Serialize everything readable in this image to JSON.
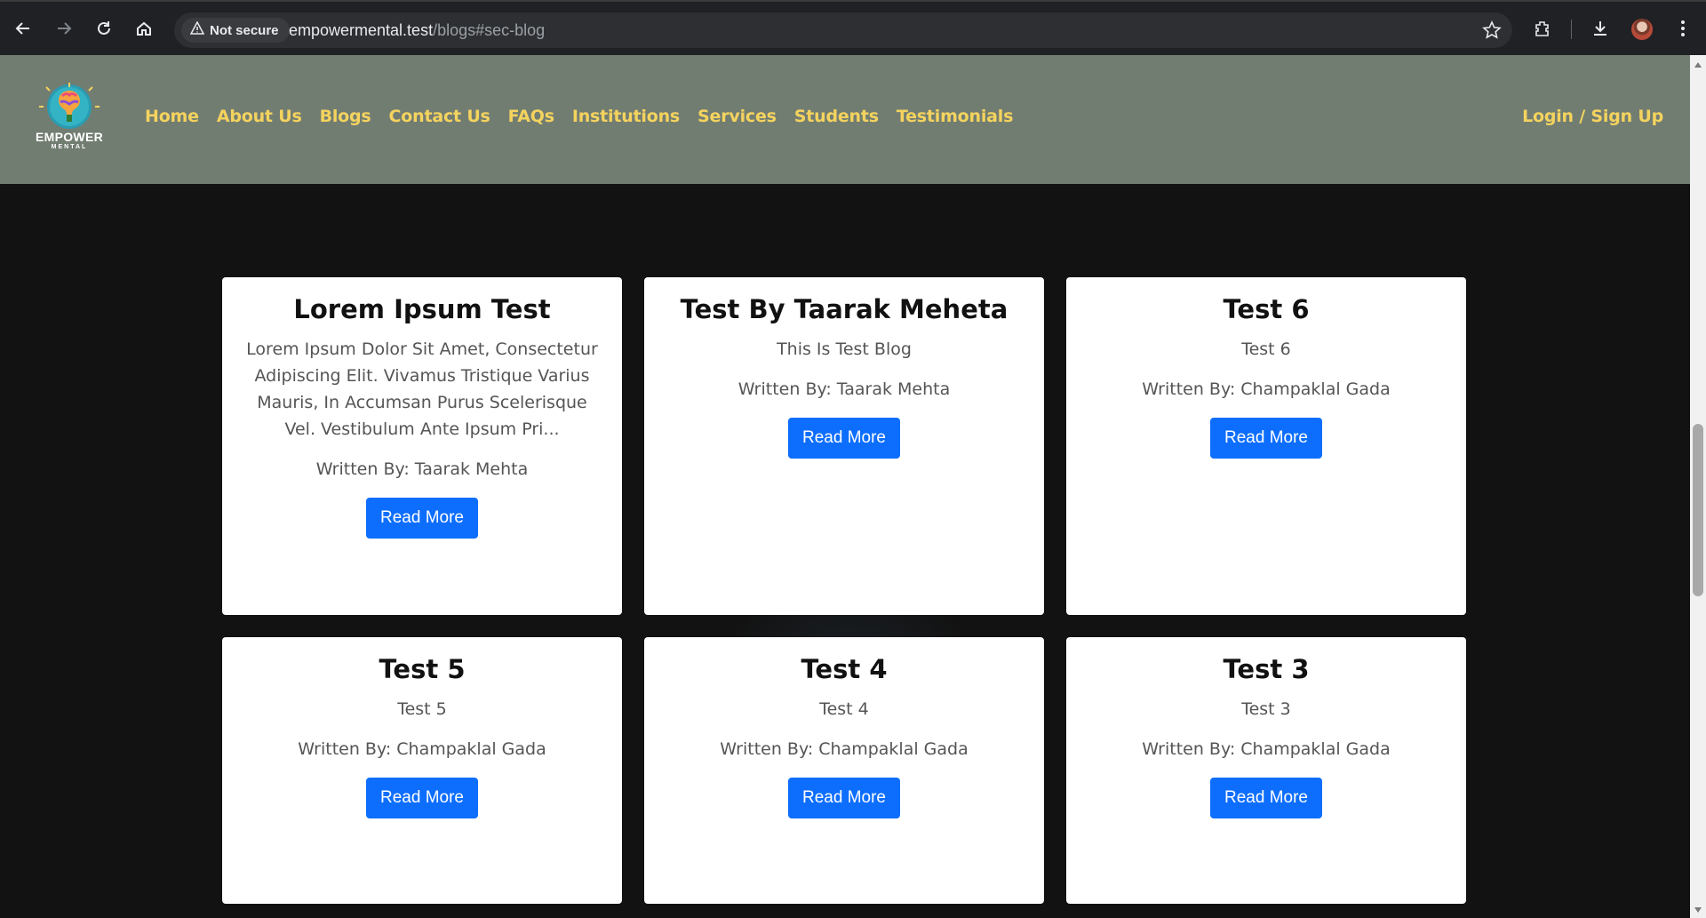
{
  "browser": {
    "security_label": "Not secure",
    "url_host": "empowermental.test",
    "url_path": "/blogs#sec-blog"
  },
  "site": {
    "logo": {
      "line1": "EMPOWER",
      "line2": "MENTAL"
    },
    "nav": [
      {
        "label": "Home"
      },
      {
        "label": "About Us"
      },
      {
        "label": "Blogs"
      },
      {
        "label": "Contact Us"
      },
      {
        "label": "FAQs"
      },
      {
        "label": "Institutions"
      },
      {
        "label": "Services"
      },
      {
        "label": "Students"
      },
      {
        "label": "Testimonials"
      }
    ],
    "login_label": "Login / Sign Up",
    "accent_color": "#f4d35e",
    "header_color": "#727d72",
    "button_color": "#0d6efd"
  },
  "blogs": [
    {
      "title": "Lorem Ipsum Test",
      "excerpt": "Lorem Ipsum Dolor Sit Amet, Consectetur Adipiscing Elit. Vivamus Tristique Varius Mauris, In Accumsan Purus Scelerisque Vel. Vestibulum Ante Ipsum Pri...",
      "author": "Written By: Taarak Mehta",
      "button": "Read More"
    },
    {
      "title": "Test By Taarak Meheta",
      "excerpt": "This Is Test Blog",
      "author": "Written By: Taarak Mehta",
      "button": "Read More"
    },
    {
      "title": "Test 6",
      "excerpt": "Test 6",
      "author": "Written By: Champaklal Gada",
      "button": "Read More"
    },
    {
      "title": "Test 5",
      "excerpt": "Test 5",
      "author": "Written By: Champaklal Gada",
      "button": "Read More"
    },
    {
      "title": "Test 4",
      "excerpt": "Test 4",
      "author": "Written By: Champaklal Gada",
      "button": "Read More"
    },
    {
      "title": "Test 3",
      "excerpt": "Test 3",
      "author": "Written By: Champaklal Gada",
      "button": "Read More"
    }
  ]
}
